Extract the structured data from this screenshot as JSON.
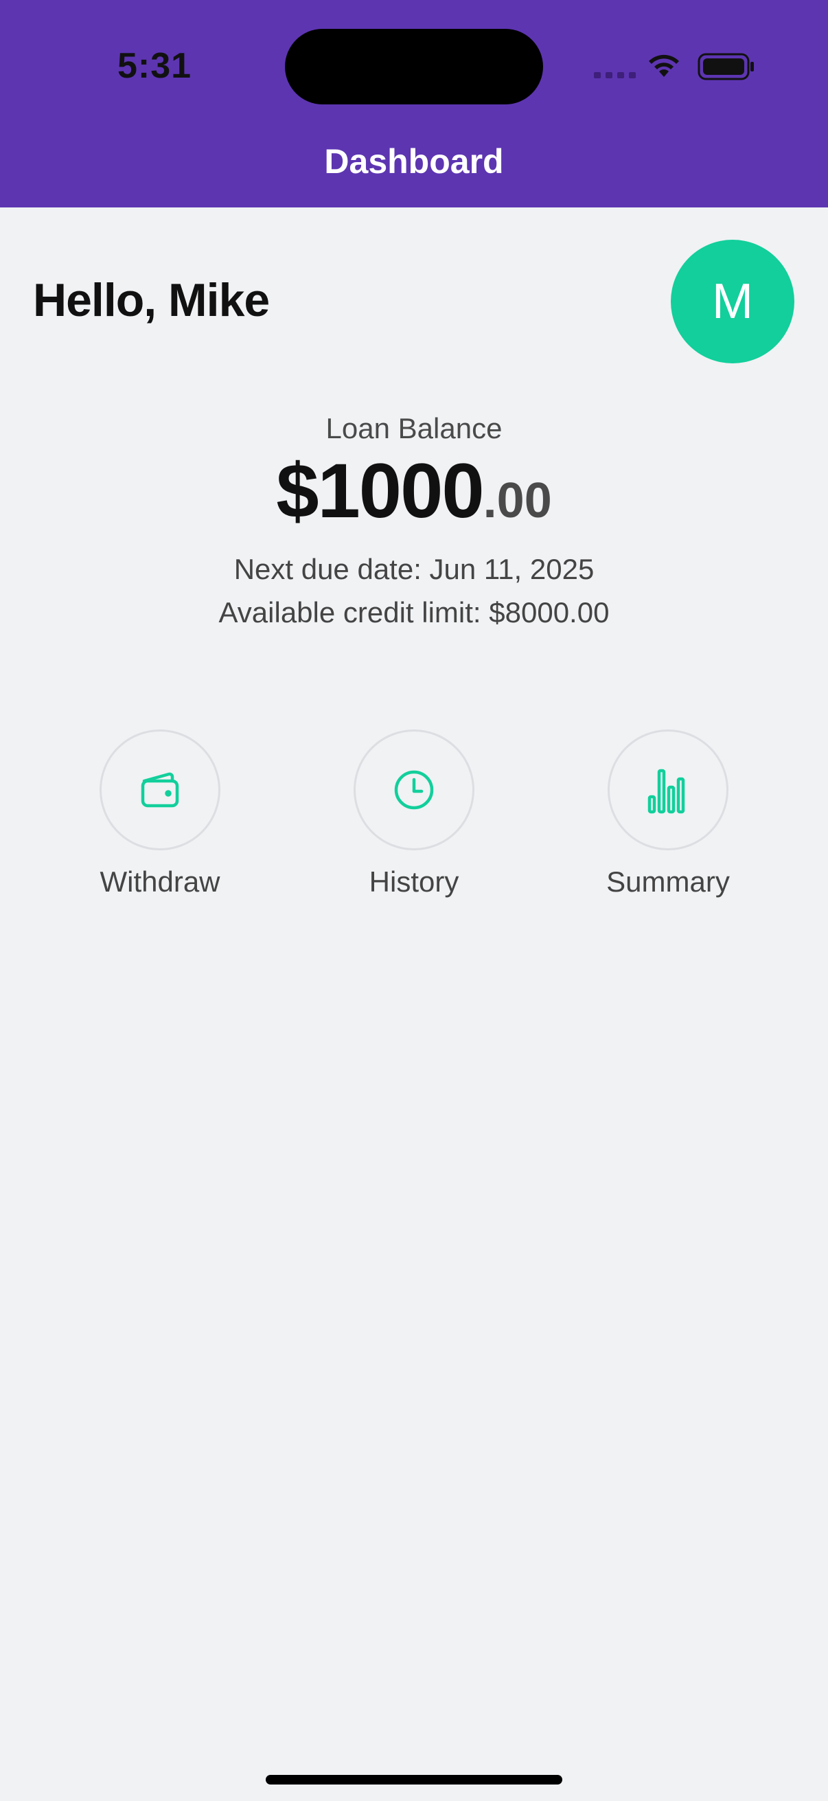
{
  "status_bar": {
    "time": "5:31"
  },
  "nav": {
    "title": "Dashboard"
  },
  "greeting": {
    "text": "Hello, Mike",
    "avatar_initial": "M"
  },
  "balance": {
    "label": "Loan Balance",
    "amount_main": "$1000",
    "amount_cents": ".00",
    "next_due": "Next due date: Jun 11, 2025",
    "credit_limit": "Available credit limit: $8000.00"
  },
  "actions": [
    {
      "label": "Withdraw",
      "icon": "wallet-icon"
    },
    {
      "label": "History",
      "icon": "clock-icon"
    },
    {
      "label": "Summary",
      "icon": "bar-chart-icon"
    }
  ],
  "colors": {
    "header": "#5d35b1",
    "accent": "#12cf9b",
    "background": "#f0f2f4"
  }
}
